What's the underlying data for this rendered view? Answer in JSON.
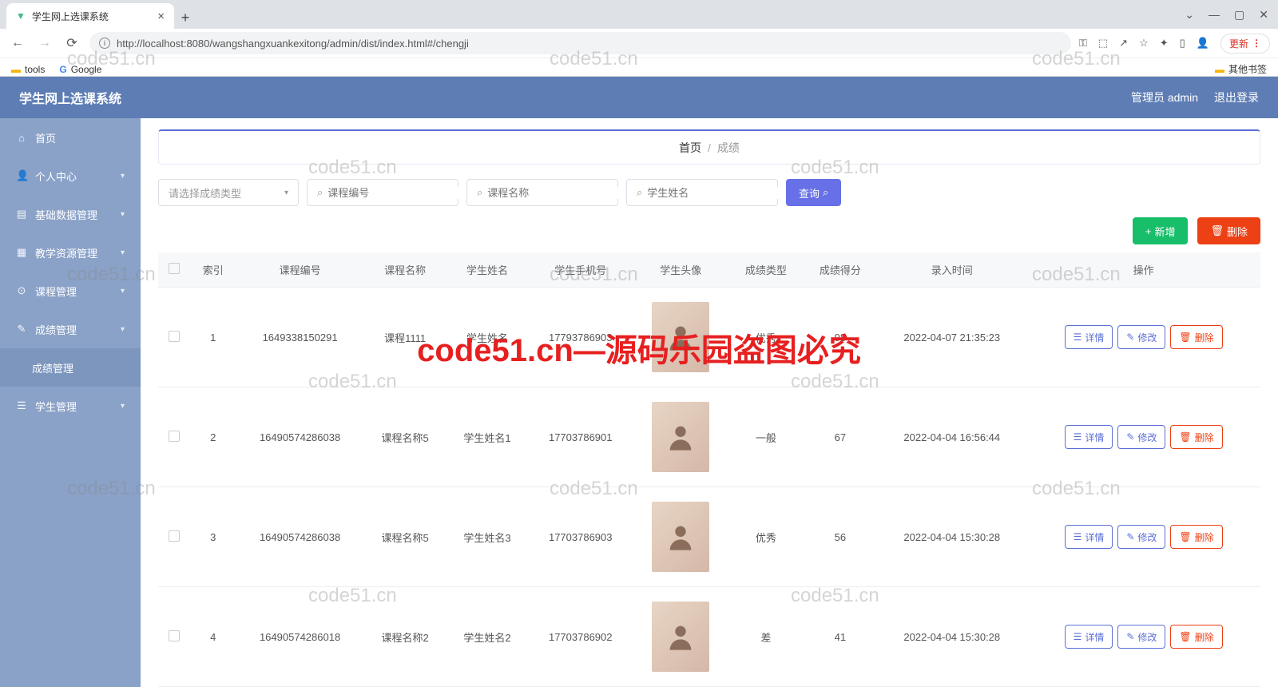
{
  "browser": {
    "tab_title": "学生网上选课系统",
    "url": "http://localhost:8080/wangshangxuankexitong/admin/dist/index.html#/chengji",
    "update_label": "更新",
    "bookmarks": {
      "tools": "tools",
      "google": "Google",
      "other": "其他书签"
    }
  },
  "header": {
    "title": "学生网上选课系统",
    "user": "管理员 admin",
    "logout": "退出登录"
  },
  "sidebar": {
    "items": [
      {
        "icon": "home",
        "label": "首页"
      },
      {
        "icon": "user",
        "label": "个人中心",
        "expandable": true
      },
      {
        "icon": "db",
        "label": "基础数据管理",
        "expandable": true
      },
      {
        "icon": "res",
        "label": "教学资源管理",
        "expandable": true
      },
      {
        "icon": "course",
        "label": "课程管理",
        "expandable": true
      },
      {
        "icon": "grade",
        "label": "成绩管理",
        "expandable": true
      },
      {
        "icon": "",
        "label": "成绩管理",
        "sub": true
      },
      {
        "icon": "student",
        "label": "学生管理",
        "expandable": true
      }
    ]
  },
  "breadcrumb": {
    "home": "首页",
    "current": "成绩"
  },
  "filters": {
    "type_placeholder": "请选择成绩类型",
    "code_placeholder": "课程编号",
    "name_placeholder": "课程名称",
    "student_placeholder": "学生姓名",
    "search_label": "查询"
  },
  "actions": {
    "add": "新增",
    "delete": "删除"
  },
  "table": {
    "headers": [
      "索引",
      "课程编号",
      "课程名称",
      "学生姓名",
      "学生手机号",
      "学生头像",
      "成绩类型",
      "成绩得分",
      "录入时间",
      "操作"
    ],
    "ops": {
      "detail": "详情",
      "edit": "修改",
      "delete": "删除"
    },
    "rows": [
      {
        "idx": "1",
        "code": "1649338150291",
        "cname": "课程1111",
        "sname": "学生姓名",
        "phone": "17793786903",
        "type": "优秀",
        "score": "98",
        "time": "2022-04-07 21:35:23"
      },
      {
        "idx": "2",
        "code": "16490574286038",
        "cname": "课程名称5",
        "sname": "学生姓名1",
        "phone": "17703786901",
        "type": "一般",
        "score": "67",
        "time": "2022-04-04 16:56:44"
      },
      {
        "idx": "3",
        "code": "16490574286038",
        "cname": "课程名称5",
        "sname": "学生姓名3",
        "phone": "17703786903",
        "type": "优秀",
        "score": "56",
        "time": "2022-04-04 15:30:28"
      },
      {
        "idx": "4",
        "code": "16490574286018",
        "cname": "课程名称2",
        "sname": "学生姓名2",
        "phone": "17703786902",
        "type": "差",
        "score": "41",
        "time": "2022-04-04 15:30:28"
      }
    ]
  },
  "watermarks": {
    "small": "code51.cn",
    "big": "code51.cn—源码乐园盗图必究"
  }
}
